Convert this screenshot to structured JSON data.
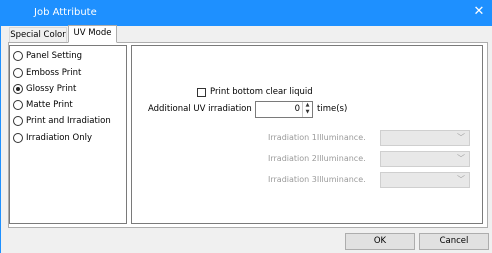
{
  "window": {
    "title": "Job Attribute",
    "close_glyph": "✕",
    "accent_color": "#1e90ff"
  },
  "tabs": [
    {
      "label": "Special Color",
      "selected": false
    },
    {
      "label": "UV Mode",
      "selected": true
    }
  ],
  "modes": [
    {
      "label": "Panel Setting",
      "checked": false
    },
    {
      "label": "Emboss Print",
      "checked": false
    },
    {
      "label": "Glossy Print",
      "checked": true
    },
    {
      "label": "Matte Print",
      "checked": false
    },
    {
      "label": "Print and Irradiation",
      "checked": false
    },
    {
      "label": "Irradiation Only",
      "checked": false
    }
  ],
  "settings": {
    "clear_liquid_label": "Print bottom clear liquid",
    "clear_liquid_checked": false,
    "uv_label": "Additional UV irradiation",
    "uv_value": "0",
    "uv_unit": "time(s)",
    "illuminance": [
      {
        "label": "Irradiation 1Illuminance.",
        "value": ""
      },
      {
        "label": "Irradiation 2Illuminance.",
        "value": ""
      },
      {
        "label": "Irradiation 3Illuminance.",
        "value": ""
      }
    ]
  },
  "buttons": {
    "ok": "OK",
    "cancel": "Cancel"
  }
}
